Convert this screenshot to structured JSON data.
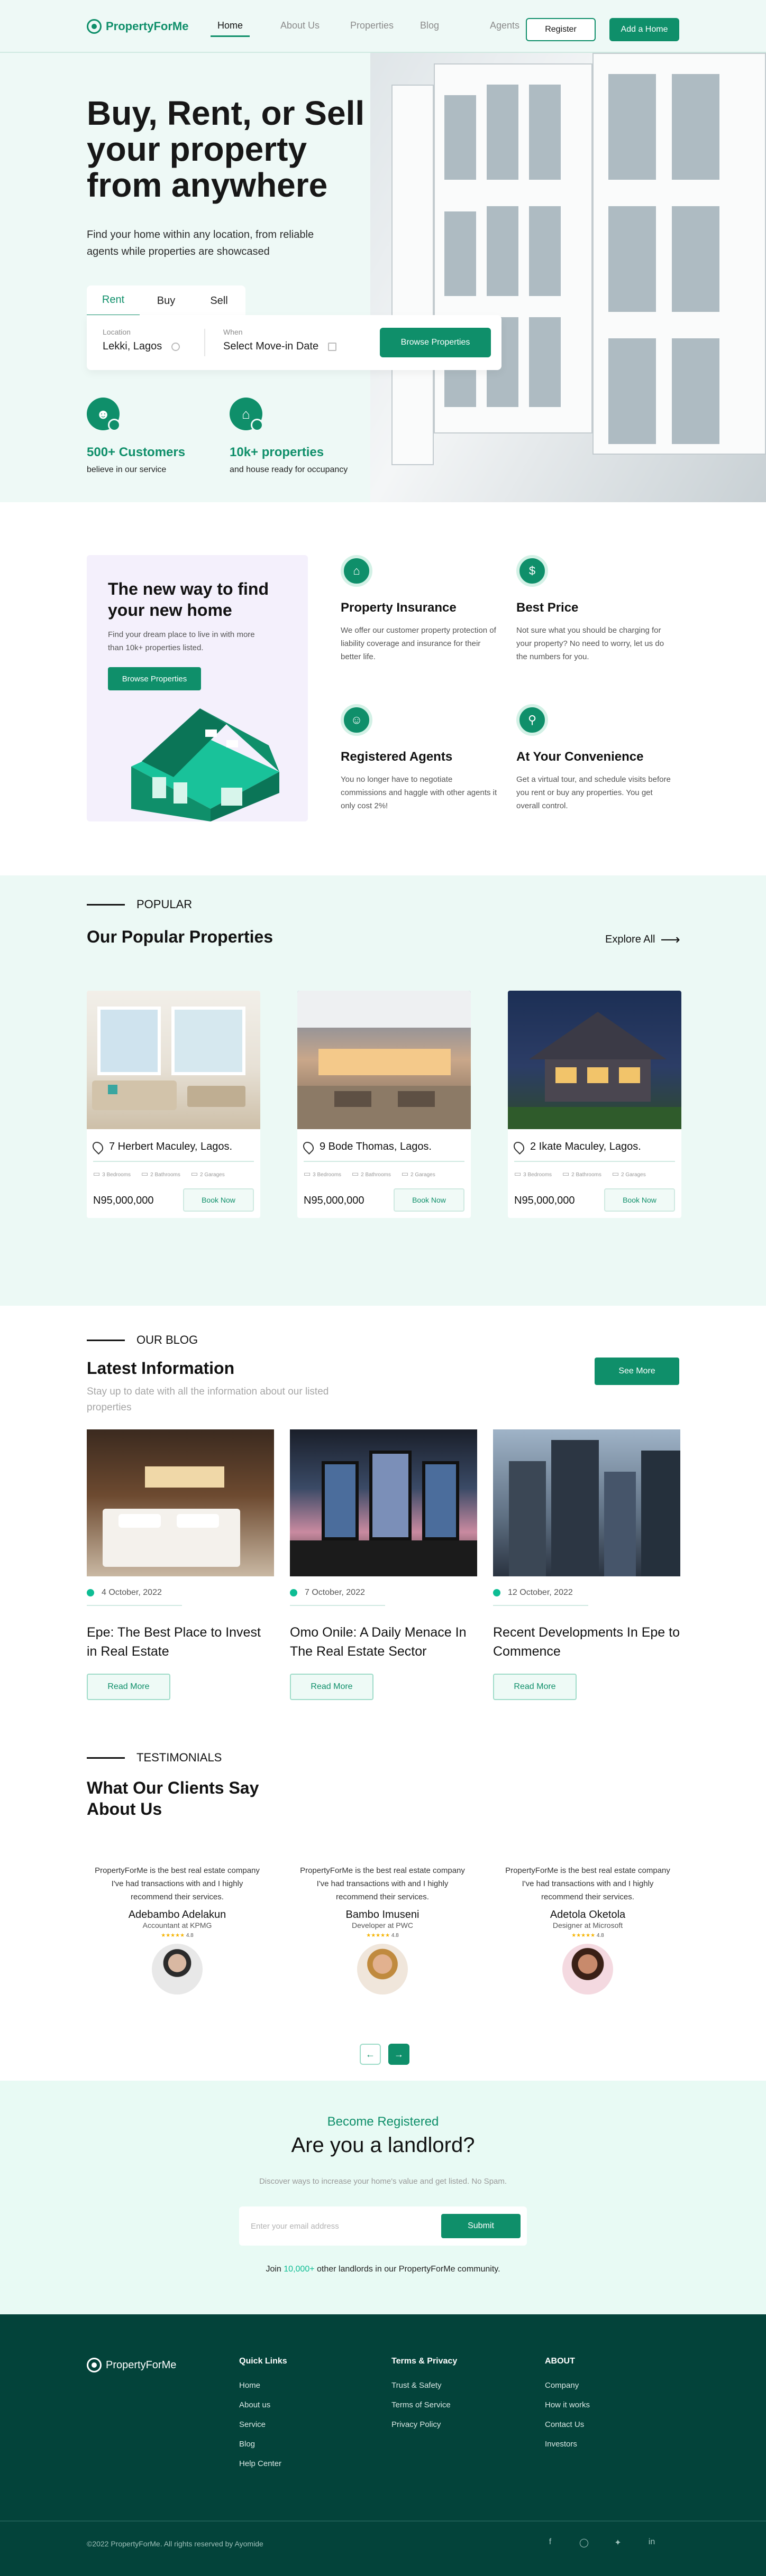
{
  "brand": {
    "name": "PropertyForMe",
    "accent": "#0f8f6a",
    "light_bg": "#eef9f6",
    "footer_bg": "#03433a"
  },
  "nav": {
    "links": [
      "Home",
      "About Us",
      "Properties",
      "Blog",
      "Agents"
    ],
    "active": "Home",
    "register_label": "Register",
    "add_home_label": "Add a Home"
  },
  "hero": {
    "title": "Buy, Rent, or Sell your property from anywhere",
    "subtitle": "Find your home within any location, from reliable agents while properties are showcased",
    "tabs": [
      "Rent",
      "Buy",
      "Sell"
    ],
    "active_tab": "Rent",
    "location_label": "Location",
    "location_value": "Lekki, Lagos",
    "when_label": "When",
    "when_value": "Select Move-in Date",
    "browse_label": "Browse Properties",
    "stats": [
      {
        "number": "500+ Customers",
        "label": "believe in our service",
        "icon": "users-icon"
      },
      {
        "number": "10k+ properties",
        "label": "and house ready for occupancy",
        "icon": "house-icon"
      }
    ]
  },
  "features": {
    "card_title": "The new way to find your new home",
    "card_text": "Find your dream place to live in with more than 10k+ properties listed.",
    "card_button": "Browse Properties",
    "items": [
      {
        "title": "Property Insurance",
        "text": "We offer our customer property protection of liability coverage and insurance for their better life.",
        "icon": "home-shield-icon"
      },
      {
        "title": "Best Price",
        "text": "Not sure what you should be charging for your property? No need to worry, let us do the numbers for you.",
        "icon": "price-tag-icon"
      },
      {
        "title": "Registered Agents",
        "text": "You no longer have to negotiate commissions and haggle with other agents it only cost 2%!",
        "icon": "agent-icon"
      },
      {
        "title": "At Your Convenience",
        "text": "Get a virtual tour, and schedule visits before you rent or buy any properties. You get overall control.",
        "icon": "search-home-icon"
      }
    ]
  },
  "popular": {
    "eyebrow": "POPULAR",
    "title": "Our Popular Properties",
    "explore_label": "Explore All",
    "properties": [
      {
        "address": "7 Herbert Maculey, Lagos.",
        "price": "N95,000,000",
        "book": "Book Now",
        "amenities": [
          "3 Bedrooms",
          "2 Bathrooms",
          "2 Garages"
        ]
      },
      {
        "address": "9 Bode Thomas, Lagos.",
        "price": "N95,000,000",
        "book": "Book Now",
        "amenities": [
          "3 Bedrooms",
          "2 Bathrooms",
          "2 Garages"
        ]
      },
      {
        "address": "2 Ikate Maculey, Lagos.",
        "price": "N95,000,000",
        "book": "Book Now",
        "amenities": [
          "3 Bedrooms",
          "2 Bathrooms",
          "2 Garages"
        ]
      }
    ]
  },
  "blog": {
    "eyebrow": "OUR BLOG",
    "title": "Latest Information",
    "subtitle": "Stay up to date with all the information about our listed properties",
    "see_more": "See More",
    "posts": [
      {
        "date": "4 October, 2022",
        "title": "Epe: The Best Place to Invest in Real Estate",
        "read": "Read More"
      },
      {
        "date": "7 October, 2022",
        "title": "Omo Onile: A Daily Menace In The Real Estate Sector",
        "read": "Read More"
      },
      {
        "date": "12 October, 2022",
        "title": "Recent Developments In Epe to Commence",
        "read": "Read More"
      }
    ]
  },
  "testimonials": {
    "eyebrow": "TESTIMONIALS",
    "title": "What Our Clients Say About Us",
    "items": [
      {
        "quote": "PropertyForMe is the best real estate company I've had transactions with and I highly recommend their services.",
        "name": "Adebambo Adelakun",
        "role": "Accountant at KPMG",
        "rating": "4.8"
      },
      {
        "quote": "PropertyForMe is the best real estate company I've had transactions with and I highly recommend their services.",
        "name": "Bambo Imuseni",
        "role": "Developer at PWC",
        "rating": "4.8"
      },
      {
        "quote": "PropertyForMe is the best real estate company I've had transactions with and I highly recommend their services.",
        "name": "Adetola Oketola",
        "role": "Designer at Microsoft",
        "rating": "4.8"
      }
    ],
    "prev_icon": "arrow-left-icon",
    "next_icon": "arrow-right-icon"
  },
  "register": {
    "kicker": "Become Registered",
    "title": "Are you a landlord?",
    "desc": "Discover ways to increase your home's value and get listed. No Spam.",
    "email_placeholder": "Enter your email address",
    "submit": "Submit",
    "join_prefix": "Join",
    "join_highlight": "10,000+",
    "join_suffix": "other landlords in our PropertyForMe community."
  },
  "footer": {
    "brand": "PropertyForMe",
    "columns": [
      {
        "title": "Quick Links",
        "links": [
          "Home",
          "About us",
          "Service",
          "Blog",
          "Help Center"
        ]
      },
      {
        "title": "Terms & Privacy",
        "links": [
          "Trust & Safety",
          "Terms of Service",
          "Privacy Policy"
        ]
      },
      {
        "title": "ABOUT",
        "links": [
          "Company",
          "How it works",
          "Contact Us",
          "Investors"
        ]
      }
    ],
    "copyright": "©2022 PropertyForMe. All rights reserved by Ayomide",
    "socials": [
      "facebook-icon",
      "instagram-icon",
      "twitter-icon",
      "linkedin-icon"
    ]
  }
}
